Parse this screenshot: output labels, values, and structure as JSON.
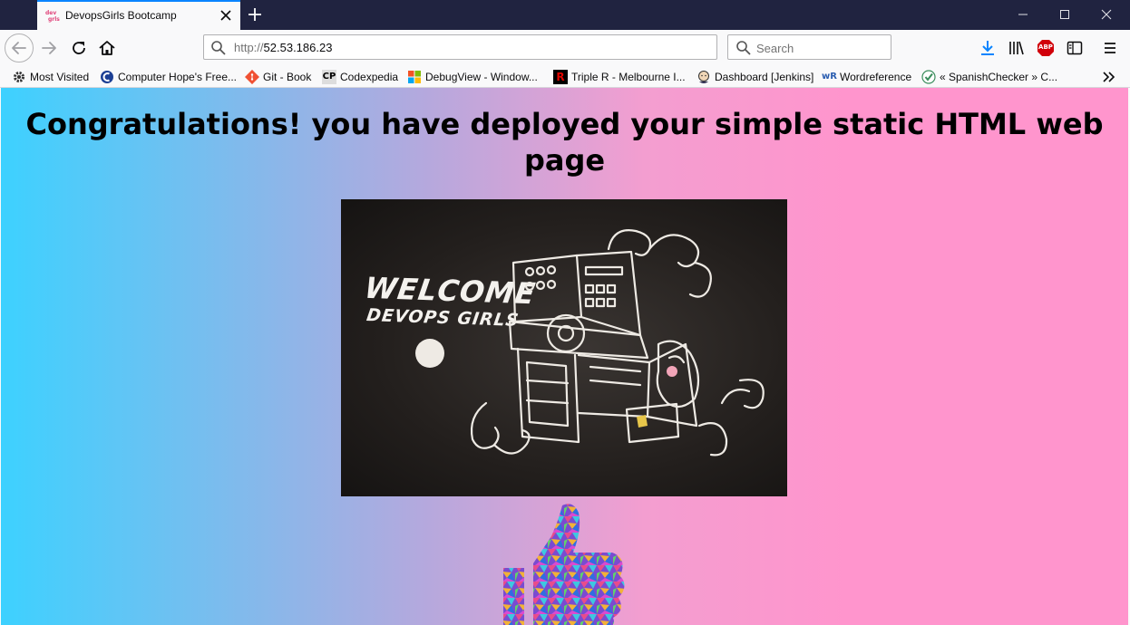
{
  "browser": {
    "tab": {
      "title": "DevopsGirls Bootcamp",
      "favicon": "devopsgirls-logo"
    },
    "url_host": "52.53.186.23",
    "url_scheme": "http://",
    "search_placeholder": "Search",
    "addon_badge": "ABP"
  },
  "bookmarks": [
    {
      "label": "Most Visited",
      "icon": "gear-icon"
    },
    {
      "label": "Computer Hope's Free...",
      "icon": "computerhope-icon"
    },
    {
      "label": "Git - Book",
      "icon": "git-icon"
    },
    {
      "label": "Codexpedia",
      "icon": "cp-icon",
      "glyph": "CP"
    },
    {
      "label": "DebugView - Window...",
      "icon": "windows-icon"
    },
    {
      "label": "Triple R - Melbourne I...",
      "icon": "triple-r-icon",
      "glyph": "R"
    },
    {
      "label": "Dashboard [Jenkins]",
      "icon": "jenkins-icon"
    },
    {
      "label": "Wordreference",
      "icon": "wordreference-icon",
      "glyph": "wR"
    },
    {
      "label": "« SpanishChecker » C...",
      "icon": "spanishchecker-icon"
    }
  ],
  "page": {
    "heading": "Congratulations! you have deployed your simple static HTML web page",
    "image_text_line1": "WELCOME",
    "image_text_line2": "DEVOPS GIRLS"
  },
  "colors": {
    "tab_accent": "#0a84ff",
    "titlebar": "#202340",
    "gradient_start": "#3dd1ff",
    "gradient_end": "#ff95cd"
  }
}
